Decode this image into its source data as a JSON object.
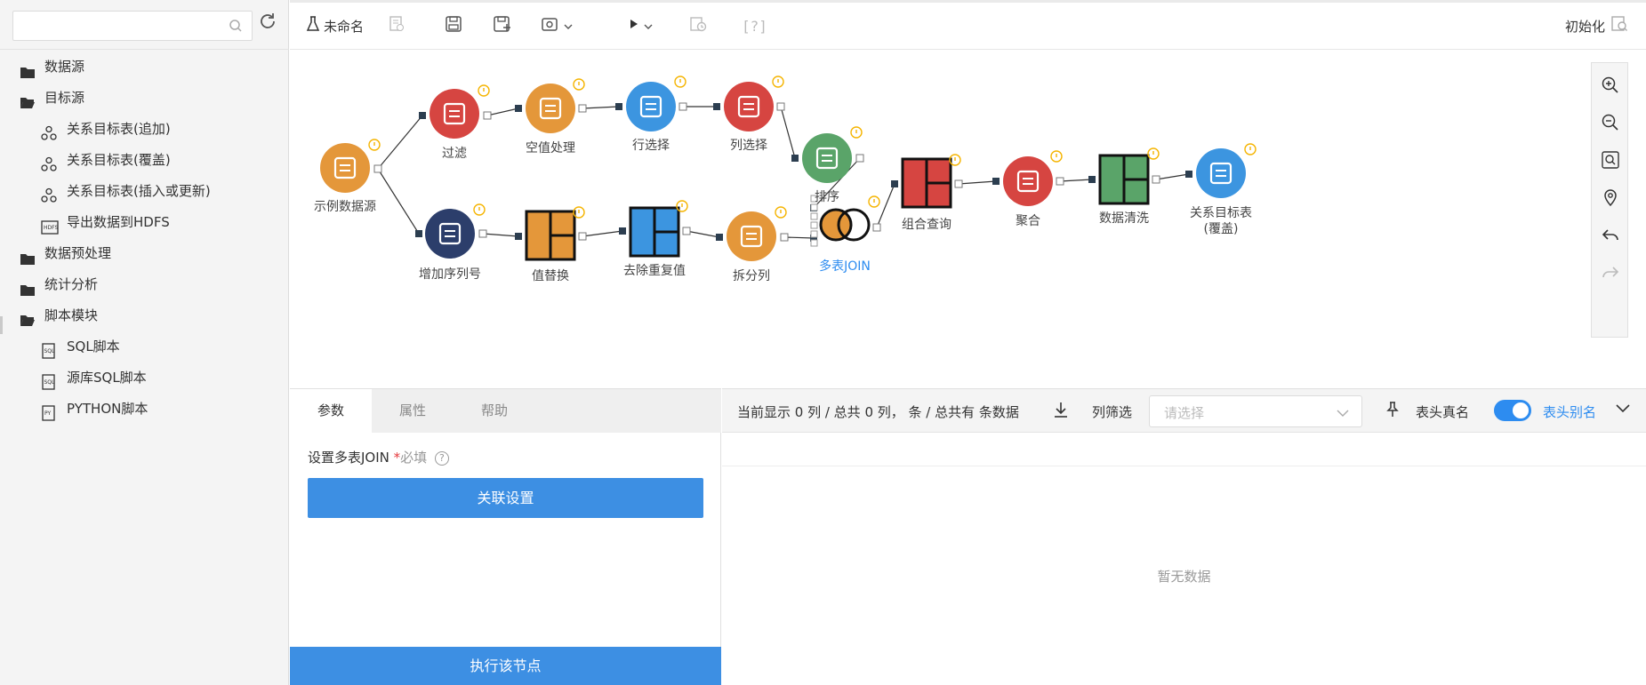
{
  "search": {
    "placeholder": ""
  },
  "tree": [
    {
      "label": "数据源",
      "level": 0,
      "icon": "folder-icon"
    },
    {
      "label": "目标源",
      "level": 0,
      "icon": "folder-open-icon"
    },
    {
      "label": "关系目标表(追加)",
      "level": 1,
      "icon": "relation-icon"
    },
    {
      "label": "关系目标表(覆盖)",
      "level": 1,
      "icon": "relation-icon"
    },
    {
      "label": "关系目标表(插入或更新)",
      "level": 1,
      "icon": "relation-icon"
    },
    {
      "label": "导出数据到HDFS",
      "level": 1,
      "icon": "hdfs-icon"
    },
    {
      "label": "数据预处理",
      "level": 0,
      "icon": "folder-icon"
    },
    {
      "label": "统计分析",
      "level": 0,
      "icon": "folder-icon"
    },
    {
      "label": "脚本模块",
      "level": 0,
      "icon": "folder-open-icon"
    },
    {
      "label": "SQL脚本",
      "level": 1,
      "icon": "sql-script-icon"
    },
    {
      "label": "源库SQL脚本",
      "level": 1,
      "icon": "sql-script-icon"
    },
    {
      "label": "PYTHON脚本",
      "level": 1,
      "icon": "python-script-icon"
    }
  ],
  "toolbar": {
    "name": "未命名",
    "init": "初始化"
  },
  "nodes": [
    {
      "id": "source",
      "label": "示例数据源",
      "color": "#e4973a",
      "icon": "database-gear-icon"
    },
    {
      "id": "filter",
      "label": "过滤",
      "color": "#d64541",
      "icon": "filter-icon"
    },
    {
      "id": "nullproc",
      "label": "空值处理",
      "color": "#e4973a",
      "icon": "null-handle-icon"
    },
    {
      "id": "rowsel",
      "label": "行选择",
      "color": "#3c95e0",
      "icon": "row-select-icon"
    },
    {
      "id": "colsel",
      "label": "列选择",
      "color": "#d64541",
      "icon": "column-select-icon"
    },
    {
      "id": "sort",
      "label": "排序",
      "color": "#5aa469",
      "icon": "sort-icon"
    },
    {
      "id": "seqno",
      "label": "增加序列号",
      "color": "#2c3e6b",
      "icon": "sequence-id-icon"
    },
    {
      "id": "replace",
      "label": "值替换",
      "color": "#e4973a",
      "icon": "value-replace-icon"
    },
    {
      "id": "dedup",
      "label": "去除重复值",
      "color": "#3c95e0",
      "icon": "dedup-icon"
    },
    {
      "id": "split",
      "label": "拆分列",
      "color": "#e4973a",
      "icon": "split-column-icon"
    },
    {
      "id": "join",
      "label": "多表JOIN",
      "color": "#e4973a",
      "icon": "join-icon"
    },
    {
      "id": "combo",
      "label": "组合查询",
      "color": "#d64541",
      "icon": "combo-query-icon"
    },
    {
      "id": "agg",
      "label": "聚合",
      "color": "#d64541",
      "icon": "aggregate-icon"
    },
    {
      "id": "clean",
      "label": "数据清洗",
      "color": "#5aa469",
      "icon": "data-clean-icon"
    },
    {
      "id": "target",
      "label": "关系目标表\n(覆盖)",
      "color": "#3c95e0",
      "icon": "relation-target-icon"
    }
  ],
  "zoom": [
    "zoom-in-icon",
    "zoom-out-icon",
    "zoom-fit-icon",
    "locate-icon",
    "undo-icon",
    "redo-icon"
  ],
  "panel": {
    "tabs": [
      "参数",
      "属性",
      "帮助"
    ],
    "setting_label": "设置多表JOIN",
    "required_mark": "*",
    "required_text": "必填",
    "assoc_button": "关联设置",
    "exec_button": "执行该节点"
  },
  "result": {
    "info": "当前显示 0 列 / 总共 0 列， 条 / 总共有 条数据",
    "column_filter": "列筛选",
    "select_placeholder": "请选择",
    "head_real": "表头真名",
    "head_alias": "表头别名",
    "empty": "暂无数据"
  }
}
